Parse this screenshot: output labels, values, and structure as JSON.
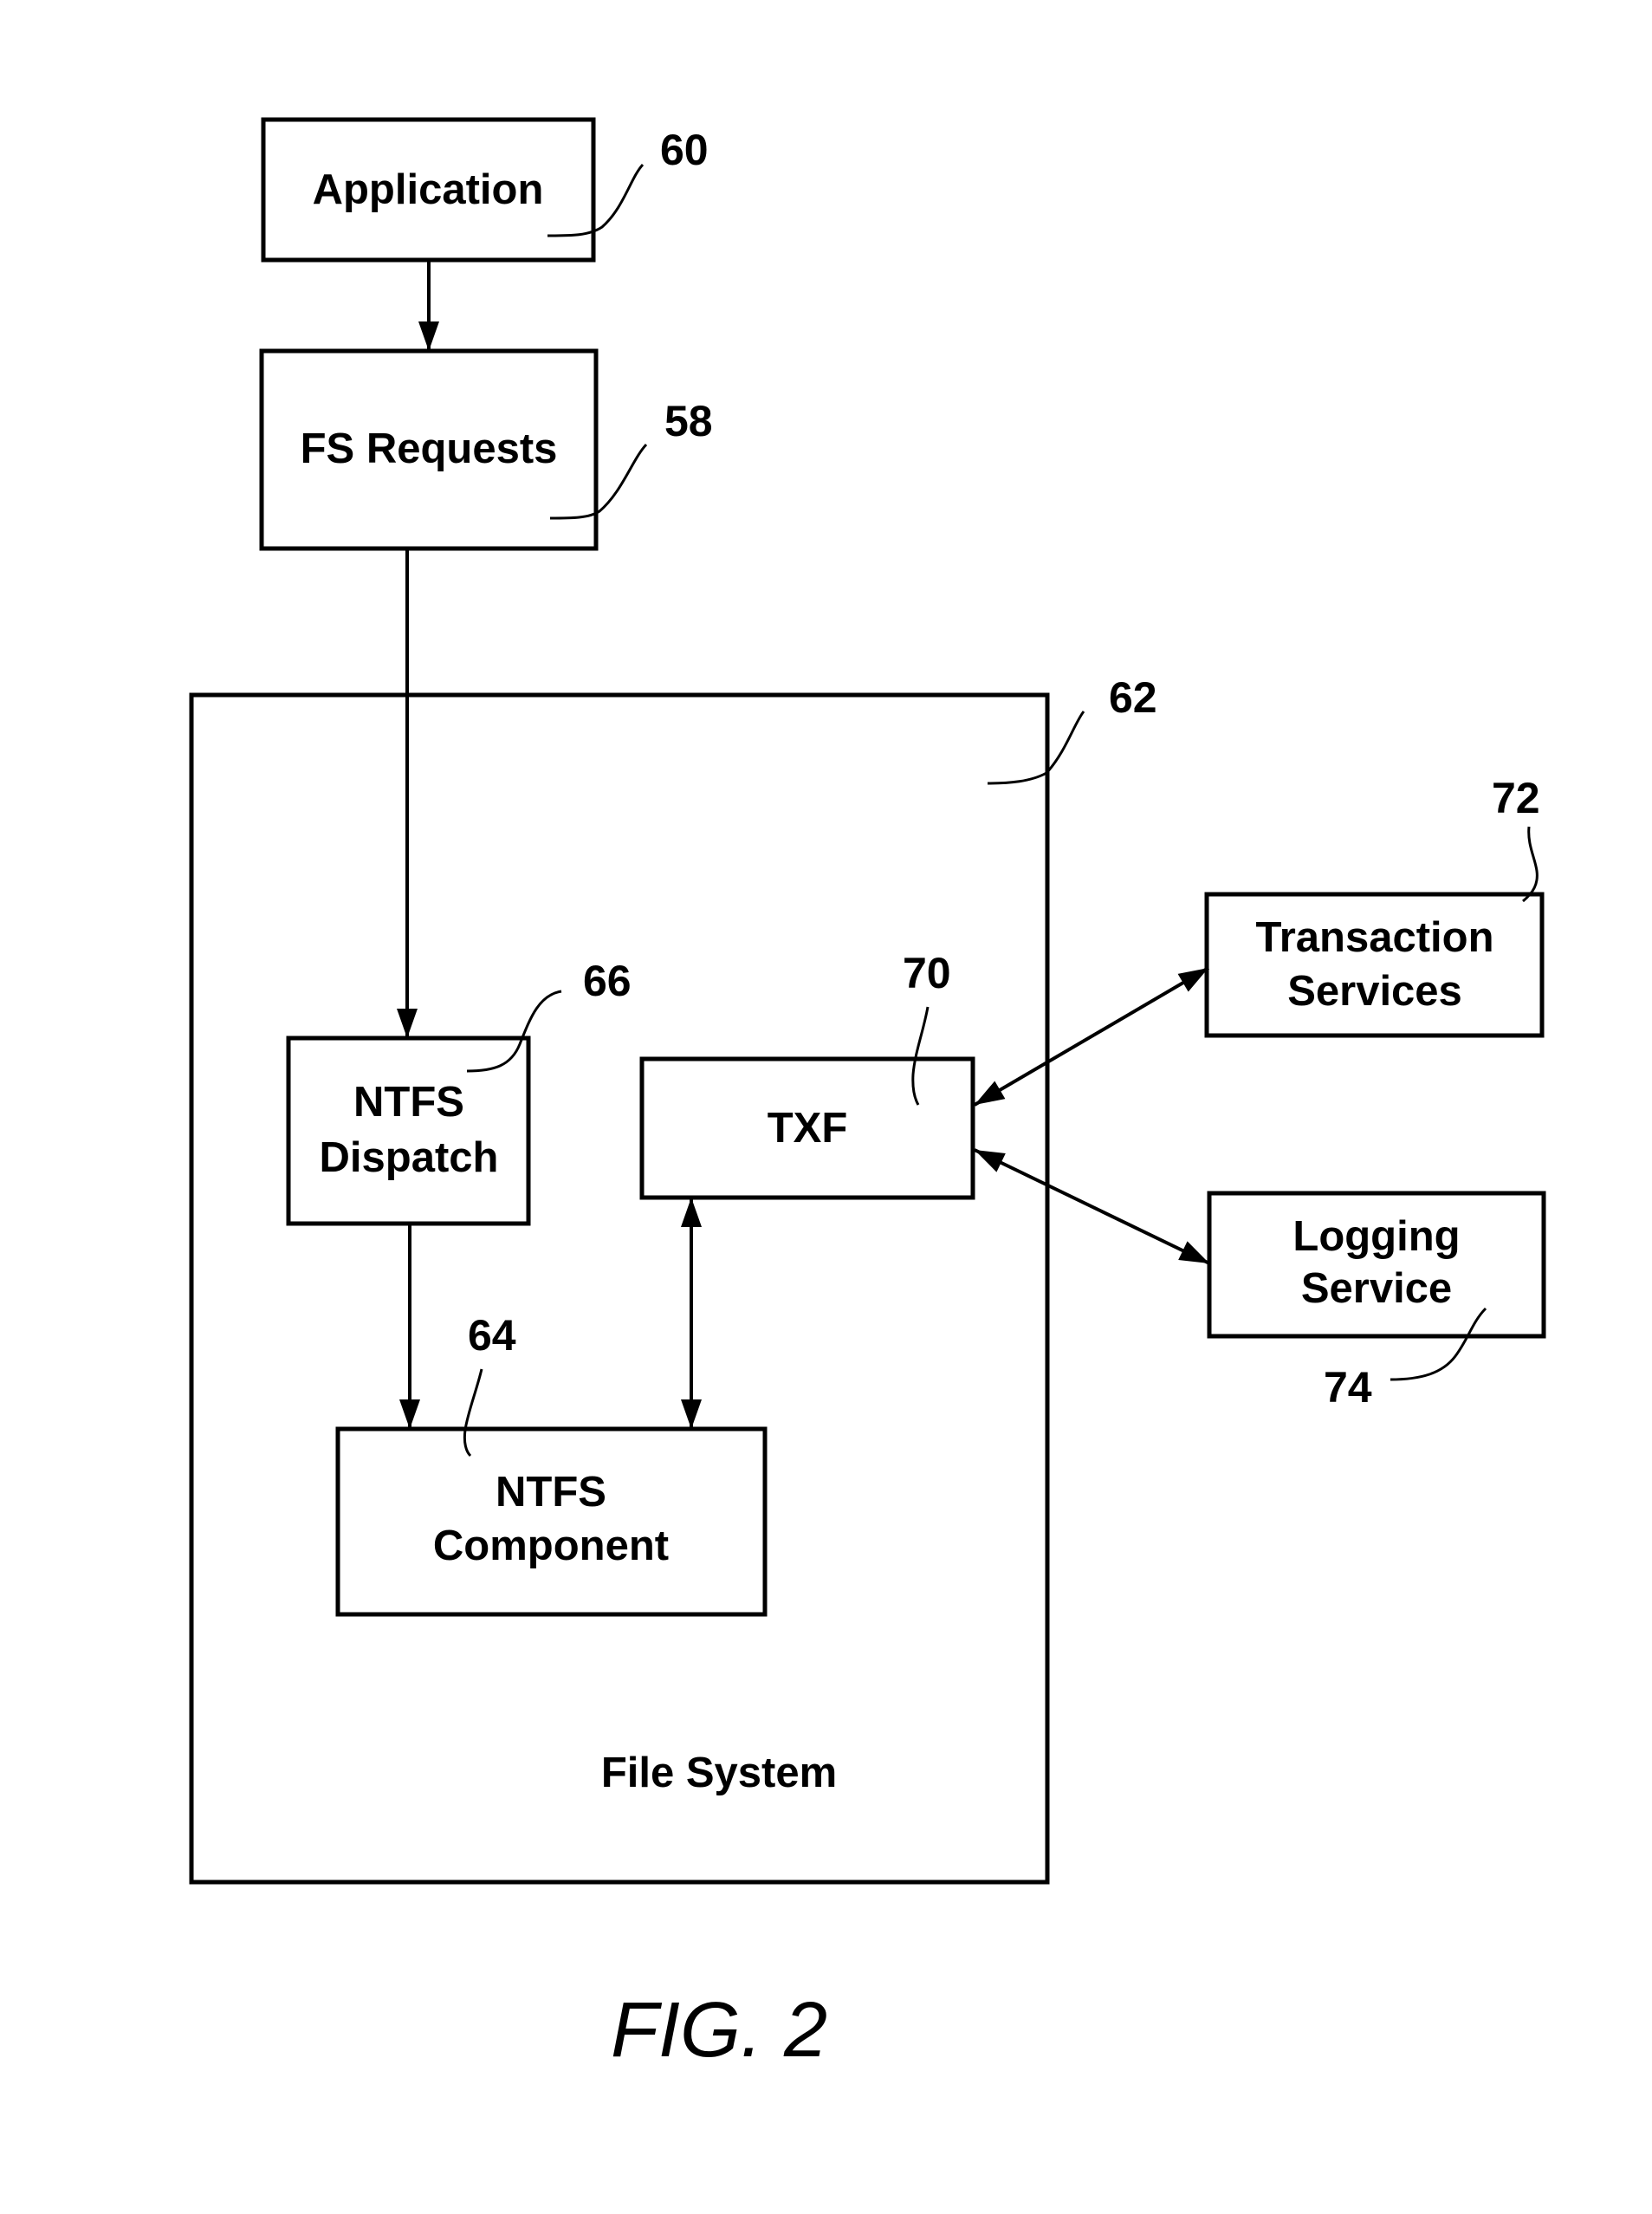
{
  "figure": {
    "caption": "FIG. 2",
    "blocks": {
      "application": {
        "lines": [
          "Application"
        ],
        "ref": "60"
      },
      "fs_requests": {
        "lines": [
          "FS Requests"
        ],
        "ref": "58"
      },
      "file_system": {
        "label": "File System",
        "ref": "62"
      },
      "ntfs_dispatch": {
        "lines": [
          "NTFS",
          "Dispatch"
        ],
        "ref": "66"
      },
      "txf": {
        "lines": [
          "TXF"
        ],
        "ref": "70"
      },
      "ntfs_component": {
        "lines": [
          "NTFS",
          "Component"
        ],
        "ref": "64"
      },
      "transaction_services": {
        "lines": [
          "Transaction",
          "Services"
        ],
        "ref": "72"
      },
      "logging_service": {
        "lines": [
          "Logging",
          "Service"
        ],
        "ref": "74"
      }
    },
    "connections": [
      {
        "from": "application",
        "to": "fs_requests",
        "direction": "forward"
      },
      {
        "from": "fs_requests",
        "to": "ntfs_dispatch",
        "direction": "forward"
      },
      {
        "from": "ntfs_dispatch",
        "to": "ntfs_component",
        "direction": "forward"
      },
      {
        "from": "txf",
        "to": "ntfs_component",
        "direction": "bidirectional"
      },
      {
        "from": "txf",
        "to": "transaction_services",
        "direction": "bidirectional"
      },
      {
        "from": "txf",
        "to": "logging_service",
        "direction": "bidirectional"
      }
    ]
  }
}
